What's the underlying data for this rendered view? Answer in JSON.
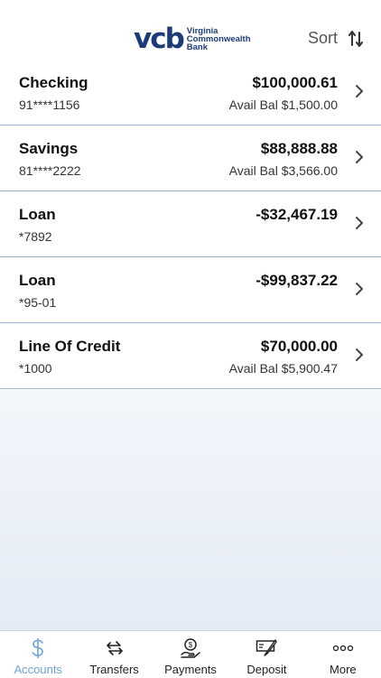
{
  "header": {
    "logo_mark": "vcb",
    "logo_lines": [
      "Virginia",
      "Commonwealth",
      "Bank"
    ],
    "sort_label": "Sort"
  },
  "accounts": [
    {
      "name": "Checking",
      "number": "91****1156",
      "amount": "$100,000.61",
      "avail": "Avail Bal $1,500.00"
    },
    {
      "name": "Savings",
      "number": "81****2222",
      "amount": "$88,888.88",
      "avail": "Avail Bal $3,566.00"
    },
    {
      "name": "Loan",
      "number": "*7892",
      "amount": "-$32,467.19",
      "avail": ""
    },
    {
      "name": "Loan",
      "number": "*95-01",
      "amount": "-$99,837.22",
      "avail": ""
    },
    {
      "name": "Line Of Credit",
      "number": "*1000",
      "amount": "$70,000.00",
      "avail": "Avail Bal $5,900.47"
    }
  ],
  "tabs": [
    {
      "label": "Accounts",
      "icon": "dollar-icon",
      "active": true
    },
    {
      "label": "Transfers",
      "icon": "transfer-arrows-icon",
      "active": false
    },
    {
      "label": "Payments",
      "icon": "payment-hand-icon",
      "active": false
    },
    {
      "label": "Deposit",
      "icon": "check-deposit-icon",
      "active": false
    },
    {
      "label": "More",
      "icon": "more-dots-icon",
      "active": false
    }
  ],
  "colors": {
    "brand": "#1b3c78",
    "active_tab": "#6fa3d8",
    "divider": "#9db3cf"
  }
}
